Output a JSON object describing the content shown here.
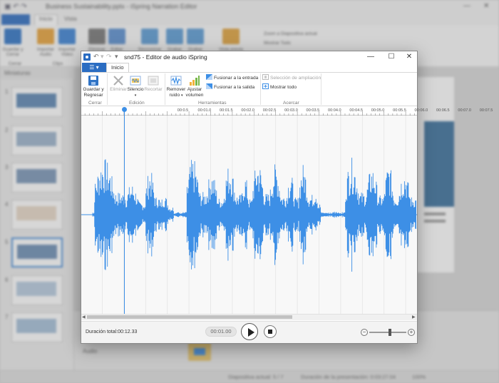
{
  "background_app": {
    "title": "Business Sustainability.pptx - iSpring Narration Editor",
    "tabs": [
      "Inicio",
      "Vista"
    ],
    "sidebar_header": "Miniaturas",
    "slide_numbers": [
      "1",
      "2",
      "3",
      "4",
      "5",
      "6",
      "7"
    ],
    "ribbon_buttons": [
      {
        "label": "Guardar y Cerrar",
        "color": "#2f73c5"
      },
      {
        "label": "Importar Audio",
        "color": "#e8a33a"
      },
      {
        "label": "Importar Video",
        "color": "#3b82d4"
      },
      {
        "label": "Eliminar",
        "color": "#777777"
      },
      {
        "label": "Editar",
        "color": "#5a8fd0"
      },
      {
        "label": "Sincronizar",
        "color": "#5b9bd5"
      },
      {
        "label": "Grabar Audio",
        "color": "#5b9bd5"
      },
      {
        "label": "Grabar Video",
        "color": "#5b9bd5"
      },
      {
        "label": "Vista previa",
        "color": "#e0a23c"
      }
    ],
    "ribbon_small": [
      "Zoom a Diapositiva actual",
      "Mostrar Todo"
    ],
    "group_labels": [
      "Cerrar",
      "Clips"
    ],
    "bottom_track_label": "Audio",
    "status": {
      "slide": "Diapositiva actual: 5 / 7",
      "duration": "Duración de la presentación: 0:03:27.04",
      "zoom": "100%"
    }
  },
  "editor": {
    "title": "snd75 - Editor de audio iSpring",
    "file_button": "☰ ▾",
    "tab": "Inicio",
    "ribbon": {
      "save": "Guardar y Regresar",
      "delete": "Eliminar",
      "silence": "Silencio",
      "crop": "Recortar",
      "noise": "Remover ruido",
      "volume": "Ajustar volumen",
      "fade_in": "Fusionar a la entrada",
      "fade_out": "Fusionar a la salida",
      "zoom_selection": "Selección de ampliación",
      "show_all": "Mostrar todo"
    },
    "groups": [
      "Cerrar",
      "Edición",
      "Herramientas",
      "Acercar"
    ],
    "ruler_ticks": [
      "00:0.5",
      "00:01.0",
      "00:01.5",
      "00:02.0",
      "00:02.5",
      "00:03.0",
      "00:03.5",
      "00:04.0",
      "00:04.5",
      "00:05.0",
      "00:05.5",
      "00:06.0",
      "00:06.5",
      "00:07.0",
      "00:07.5"
    ],
    "duration_label": "Duración total:00:12.33",
    "current_time": "00:01.00",
    "accent_color": "#3d8fe6",
    "waveform_color": "#3d8fe6"
  }
}
